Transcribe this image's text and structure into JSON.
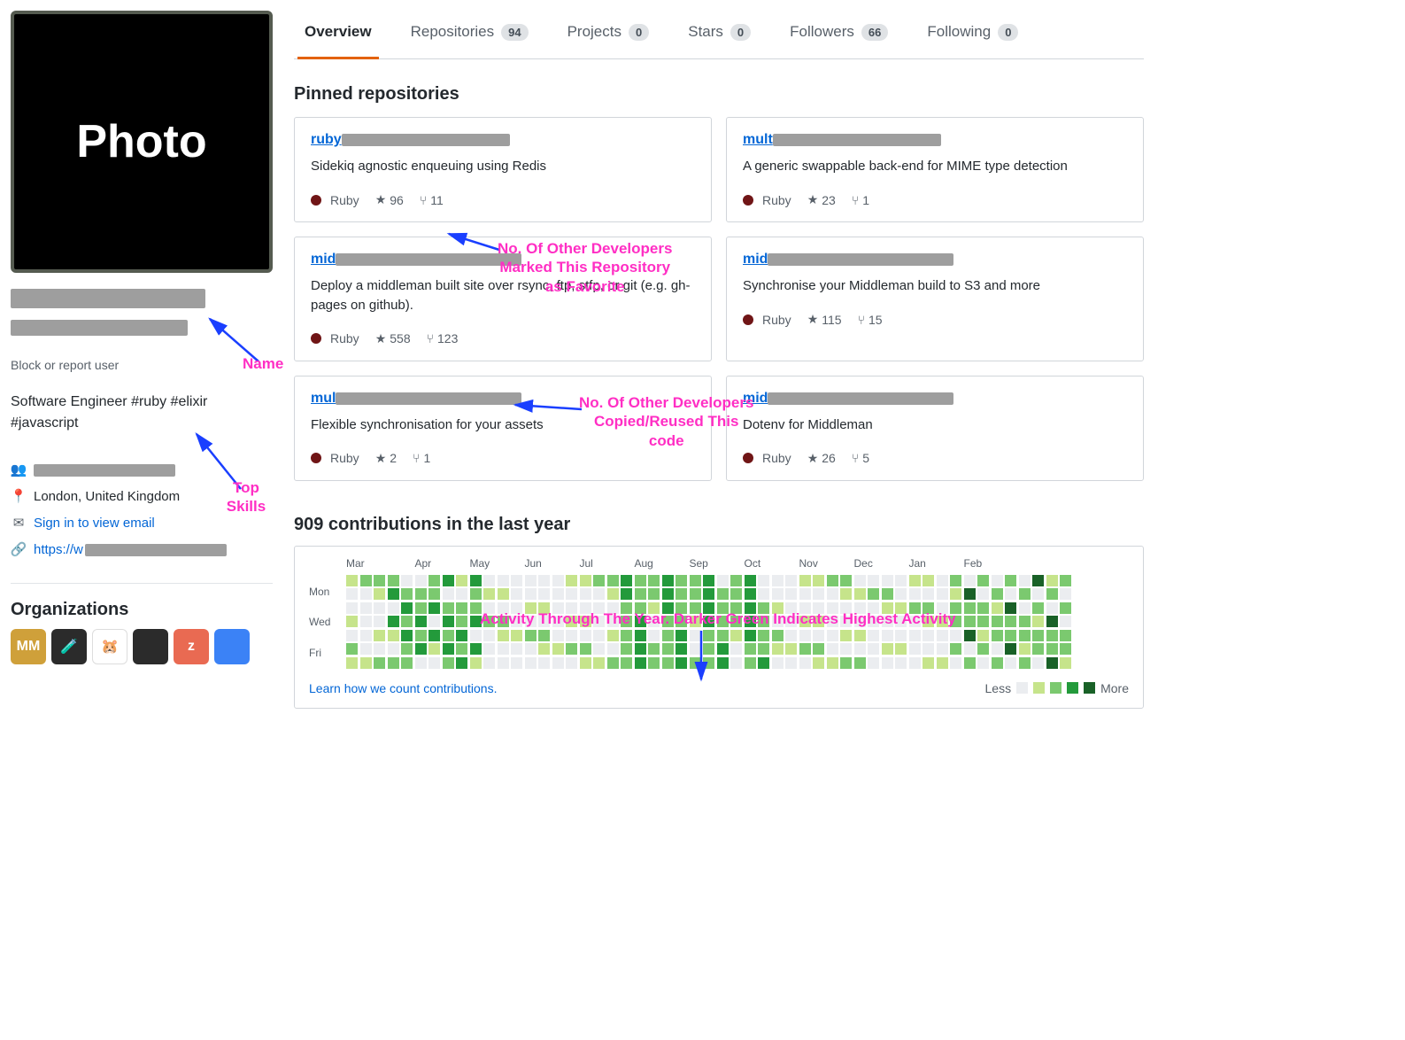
{
  "profile": {
    "photo_label": "Photo",
    "block_report": "Block or report user",
    "bio": "Software Engineer #ruby #elixir #javascript",
    "location": "London, United Kingdom",
    "email_cta": "Sign in to view email",
    "url_prefix": "https://w",
    "orgs_heading": "Organizations",
    "orgs": [
      {
        "bg": "#cfa03a",
        "text": "MM"
      },
      {
        "bg": "#2b2b2b",
        "text": "🧪"
      },
      {
        "bg": "#ffffff",
        "text": "🐹"
      },
      {
        "bg": "#2b2b2b",
        "text": ""
      },
      {
        "bg": "#e96a52",
        "text": "z"
      },
      {
        "bg": "#3b82f6",
        "text": ""
      }
    ]
  },
  "tabs": [
    {
      "label": "Overview",
      "count": null,
      "active": true
    },
    {
      "label": "Repositories",
      "count": "94",
      "active": false
    },
    {
      "label": "Projects",
      "count": "0",
      "active": false
    },
    {
      "label": "Stars",
      "count": "0",
      "active": false
    },
    {
      "label": "Followers",
      "count": "66",
      "active": false
    },
    {
      "label": "Following",
      "count": "0",
      "active": false
    }
  ],
  "pinned_heading": "Pinned repositories",
  "pins": [
    {
      "name": "ruby",
      "redact_w": 190,
      "desc": "Sidekiq agnostic enqueuing using Redis",
      "lang": "Ruby",
      "stars": "96",
      "forks": "11"
    },
    {
      "name": "mult",
      "redact_w": 190,
      "desc": "A generic swappable back-end for MIME type detection",
      "lang": "Ruby",
      "stars": "23",
      "forks": "1"
    },
    {
      "name": "mid",
      "redact_w": 210,
      "desc": "Deploy a middleman built site over rsync, ftp, stfp, or git (e.g. gh-pages on github).",
      "lang": "Ruby",
      "stars": "558",
      "forks": "123"
    },
    {
      "name": "mid",
      "redact_w": 210,
      "desc": "Synchronise your Middleman build to S3 and more",
      "lang": "Ruby",
      "stars": "115",
      "forks": "15"
    },
    {
      "name": "mul",
      "redact_w": 210,
      "desc": "Flexible synchronisation for your assets",
      "lang": "Ruby",
      "stars": "2",
      "forks": "1"
    },
    {
      "name": "mid",
      "redact_w": 210,
      "desc": "Dotenv for Middleman",
      "lang": "Ruby",
      "stars": "26",
      "forks": "5"
    }
  ],
  "contrib": {
    "title": "909 contributions in the last year",
    "months": [
      "Mar",
      "Apr",
      "May",
      "Jun",
      "Jul",
      "Aug",
      "Sep",
      "Oct",
      "Nov",
      "Dec",
      "Jan",
      "Feb"
    ],
    "dow": [
      "Mon",
      "Wed",
      "Fri"
    ],
    "learn_link": "Learn how we count contributions.",
    "legend_less": "Less",
    "legend_more": "More"
  },
  "annotations": {
    "name": "Name",
    "top_skills": "Top Skills",
    "stars": "No. Of Other Developers\nMarked This Repository\nas Favorite",
    "forks": "No. Of Other Developers\nCopied/Reused This\ncode",
    "activity": "Activity Through The Year. Darker Green Indicates Highest Activity"
  },
  "icons": {
    "org": "👥",
    "location": "📍",
    "mail": "✉",
    "link": "🔗",
    "star": "★",
    "fork": "⑂"
  }
}
